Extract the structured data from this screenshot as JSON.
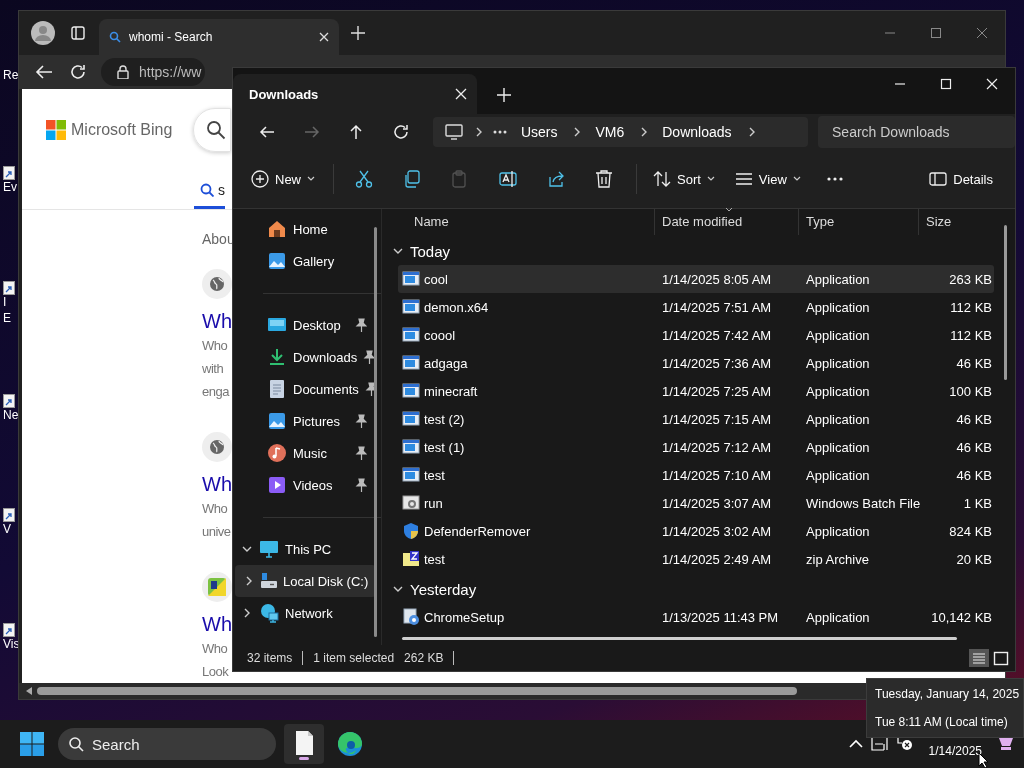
{
  "desktop_icons": [
    {
      "label": "Re",
      "shortcut": false
    },
    {
      "label": "Ev",
      "shortcut": true
    },
    {
      "label": "I",
      "shortcut": true
    },
    {
      "label": "E",
      "shortcut": false
    },
    {
      "label": "Ne",
      "shortcut": true
    },
    {
      "label": "V",
      "shortcut": true
    },
    {
      "label": "Vis",
      "shortcut": true
    }
  ],
  "browser": {
    "tab": {
      "title": "whomi - Search"
    },
    "address": "https://ww",
    "page": {
      "logo": "Microsoft Bing",
      "search_tab": "s",
      "results_info": "Abou",
      "results": [
        {
          "kind": "globe",
          "title": "Wh",
          "snippet": [
            "Who",
            "with",
            "enga"
          ]
        },
        {
          "kind": "globe",
          "title": "Wh",
          "snippet": [
            "Who",
            "unive"
          ]
        },
        {
          "kind": "site",
          "title": "Wh",
          "snippet": [
            "Who",
            "Look"
          ]
        }
      ]
    }
  },
  "explorer": {
    "tab": {
      "title": "Downloads"
    },
    "nav_buttons": [
      {
        "kind": "back",
        "disabled": false
      },
      {
        "kind": "forward",
        "disabled": true
      },
      {
        "kind": "up",
        "disabled": false
      },
      {
        "kind": "refresh",
        "disabled": false
      }
    ],
    "breadcrumb": [
      "Users",
      "VM6",
      "Downloads"
    ],
    "search": {
      "placeholder": "Search Downloads"
    },
    "toolbar": [
      {
        "kind": "new",
        "label": "New",
        "disabled": false
      },
      {
        "kind": "cut",
        "disabled": false
      },
      {
        "kind": "copy",
        "disabled": false
      },
      {
        "kind": "paste",
        "disabled": true
      },
      {
        "kind": "rename",
        "disabled": false
      },
      {
        "kind": "share",
        "disabled": false
      },
      {
        "kind": "delete",
        "disabled": false
      },
      {
        "kind": "sort",
        "label": "Sort",
        "disabled": false
      },
      {
        "kind": "view",
        "label": "View",
        "disabled": false
      },
      {
        "kind": "more",
        "disabled": false
      },
      {
        "kind": "details",
        "label": "Details",
        "disabled": false
      }
    ],
    "nav_pane": [
      {
        "kind": "home",
        "label": "Home",
        "pinned": false,
        "selected": false
      },
      {
        "kind": "gallery",
        "label": "Gallery",
        "pinned": false,
        "selected": false
      },
      {
        "kind": "divider"
      },
      {
        "kind": "desktop",
        "label": "Desktop",
        "pinned": true,
        "selected": false
      },
      {
        "kind": "downloads",
        "label": "Downloads",
        "pinned": true,
        "selected": false
      },
      {
        "kind": "documents",
        "label": "Documents",
        "pinned": true,
        "selected": false
      },
      {
        "kind": "pictures",
        "label": "Pictures",
        "pinned": true,
        "selected": false
      },
      {
        "kind": "music",
        "label": "Music",
        "pinned": true,
        "selected": false
      },
      {
        "kind": "videos",
        "label": "Videos",
        "pinned": true,
        "selected": false
      },
      {
        "kind": "divider"
      },
      {
        "kind": "pc",
        "label": "This PC",
        "expanded": true,
        "selected": false,
        "children": [
          {
            "kind": "disk",
            "label": "Local Disk (C:)",
            "expanded": false,
            "selected": true
          }
        ]
      },
      {
        "kind": "network",
        "label": "Network",
        "expanded": false,
        "selected": false
      }
    ],
    "columns": [
      {
        "label": "Name",
        "sorted": false
      },
      {
        "label": "Date modified",
        "sorted": true
      },
      {
        "label": "Type",
        "sorted": false
      },
      {
        "label": "Size",
        "sorted": false
      }
    ],
    "groups": [
      {
        "label": "Today",
        "expanded": true,
        "files": [
          {
            "kind": "app",
            "name": "cool",
            "date": "1/14/2025 8:05 AM",
            "type": "Application",
            "size": "263 KB",
            "selected": true
          },
          {
            "kind": "app",
            "name": "demon.x64",
            "date": "1/14/2025 7:51 AM",
            "type": "Application",
            "size": "112 KB",
            "selected": false
          },
          {
            "kind": "app",
            "name": "coool",
            "date": "1/14/2025 7:42 AM",
            "type": "Application",
            "size": "112 KB",
            "selected": false
          },
          {
            "kind": "app",
            "name": "adgaga",
            "date": "1/14/2025 7:36 AM",
            "type": "Application",
            "size": "46 KB",
            "selected": false
          },
          {
            "kind": "app",
            "name": "minecraft",
            "date": "1/14/2025 7:25 AM",
            "type": "Application",
            "size": "100 KB",
            "selected": false
          },
          {
            "kind": "app",
            "name": "test (2)",
            "date": "1/14/2025 7:15 AM",
            "type": "Application",
            "size": "46 KB",
            "selected": false
          },
          {
            "kind": "app",
            "name": "test (1)",
            "date": "1/14/2025 7:12 AM",
            "type": "Application",
            "size": "46 KB",
            "selected": false
          },
          {
            "kind": "app",
            "name": "test",
            "date": "1/14/2025 7:10 AM",
            "type": "Application",
            "size": "46 KB",
            "selected": false
          },
          {
            "kind": "batch",
            "name": "run",
            "date": "1/14/2025 3:07 AM",
            "type": "Windows Batch File",
            "size": "1 KB",
            "selected": false
          },
          {
            "kind": "shield",
            "name": "DefenderRemover",
            "date": "1/14/2025 3:02 AM",
            "type": "Application",
            "size": "824 KB",
            "selected": false
          },
          {
            "kind": "zip",
            "name": "test",
            "date": "1/14/2025 2:49 AM",
            "type": "zip Archive",
            "size": "20 KB",
            "selected": false
          }
        ]
      },
      {
        "label": "Yesterday",
        "expanded": true,
        "files": [
          {
            "kind": "setup",
            "name": "ChromeSetup",
            "date": "1/13/2025 11:43 PM",
            "type": "Application",
            "size": "10,142 KB",
            "selected": false
          }
        ]
      }
    ],
    "status": {
      "items": "32 items",
      "selection": "1 item selected",
      "selection_size": "262 KB"
    },
    "view_modes": [
      {
        "kind": "details",
        "selected": true
      },
      {
        "kind": "tiles",
        "selected": false
      }
    ]
  },
  "clock_tooltip": {
    "date": "Tuesday, January 14, 2025",
    "time": "Tue 8:11 AM (Local time)"
  },
  "taskbar": {
    "search": {
      "placeholder": "Search"
    },
    "apps": [
      {
        "kind": "file",
        "active": true
      },
      {
        "kind": "edge",
        "active": false
      }
    ],
    "tray": {
      "date": "1/14/2025"
    }
  }
}
